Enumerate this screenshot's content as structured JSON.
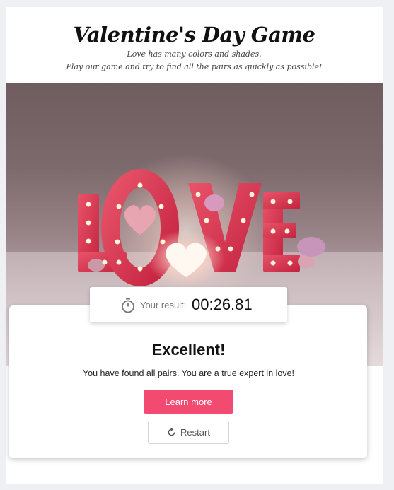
{
  "header": {
    "title": "Valentine's Day Game",
    "subtitle_line1": "Love has many colors and shades.",
    "subtitle_line2": "Play our game and try to find all the pairs as quickly as possible!"
  },
  "hero": {
    "word": "LOVE",
    "image_description_icon": "love-marquee-letters-image"
  },
  "result": {
    "timer_icon": "stopwatch-icon",
    "label": "Your result:",
    "time": "00:26.81",
    "headline": "Excellent!",
    "message": "You have found all pairs. You are a true expert in love!",
    "learn_more_label": "Learn more",
    "restart_label": "Restart",
    "restart_icon": "refresh-icon"
  },
  "colors": {
    "accent": "#f24a70",
    "page_bg": "#eef0f3",
    "card_bg": "#ffffff"
  }
}
